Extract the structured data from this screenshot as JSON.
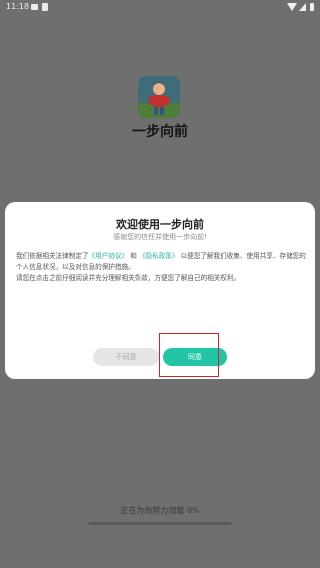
{
  "status_bar": {
    "time": "11:18"
  },
  "app": {
    "name": "一步向前",
    "icon": "app-game-icon"
  },
  "dialog": {
    "title": "欢迎使用一步向前",
    "subtitle": "感谢您的信任并使用一步向前!",
    "body": {
      "p1_start": "我们依据相关法律制定了",
      "link_agreement": "《用户协议》",
      "p1_and": "和",
      "link_privacy": "《隐私政策》",
      "p1_end": "以便您了解我们收集、使用共享、存储您的个人信息状况，以及对信息的保护措施。",
      "p2": "请您在点击之前仔细阅读并充分理解相关条款，方便您了解自己的相关权利。"
    },
    "decline_label": "不同意",
    "agree_label": "同意"
  },
  "loading": {
    "text": "正在为你努力加载 0%",
    "progress": 0
  },
  "colors": {
    "accent": "#21c4a4",
    "overlay": "#6f6f6f",
    "highlight": "#d82020"
  }
}
